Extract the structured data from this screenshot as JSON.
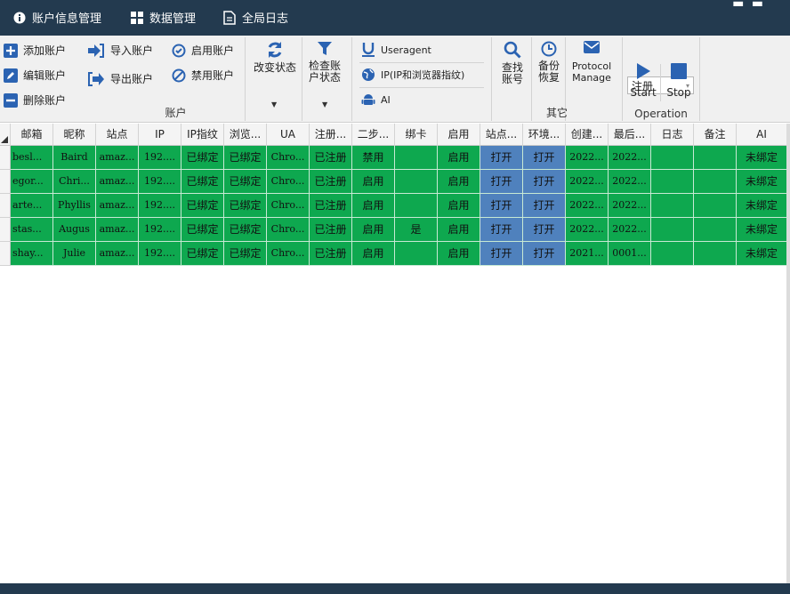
{
  "topnav": [
    {
      "label": "账户信息管理",
      "icon": "info-icon"
    },
    {
      "label": "数据管理",
      "icon": "grid-icon"
    },
    {
      "label": "全局日志",
      "icon": "document-icon"
    }
  ],
  "ribbon": {
    "account": {
      "add": "添加账户",
      "edit": "编辑账户",
      "delete": "删除账户",
      "import": "导入账户",
      "export": "导出账户",
      "enable": "启用账户",
      "disable": "禁用账户",
      "change_status": "改变状态",
      "check_status": "检查账户状态",
      "label": "账户"
    },
    "profile": {
      "useragent": "Useragent",
      "ip_fp": "IP(IP和浏览器指纹)",
      "ai": "AI"
    },
    "other": {
      "find": "查找账号",
      "backup": "备份恢复",
      "protocol": "Protocol Manage",
      "label": "其它"
    },
    "operation": {
      "select_value": "注册",
      "start": "Start",
      "stop": "Stop",
      "label": "Operation"
    }
  },
  "colors": {
    "topbar": "#233a4f",
    "row_green": "#0ea84f",
    "cell_blue": "#4f81bd",
    "icon_blue": "#2b63b2"
  },
  "table": {
    "columns": [
      "邮箱",
      "昵称",
      "站点",
      "IP",
      "IP指纹",
      "浏览...",
      "UA",
      "注册...",
      "二步...",
      "绑卡",
      "启用",
      "站点...",
      "环境...",
      "创建...",
      "最后...",
      "日志",
      "备注",
      "AI"
    ],
    "rows": [
      [
        "besl...",
        "Baird",
        "amaz...",
        "192....",
        "已绑定",
        "已绑定",
        "Chro...",
        "已注册",
        "禁用",
        "",
        "启用",
        "打开",
        "打开",
        "2022...",
        "2022...",
        "",
        "",
        "未绑定"
      ],
      [
        "egor...",
        "Chri...",
        "amaz...",
        "192....",
        "已绑定",
        "已绑定",
        "Chro...",
        "已注册",
        "启用",
        "",
        "启用",
        "打开",
        "打开",
        "2022...",
        "2022...",
        "",
        "",
        "未绑定"
      ],
      [
        "arte...",
        "Phyllis",
        "amaz...",
        "192....",
        "已绑定",
        "已绑定",
        "Chro...",
        "已注册",
        "启用",
        "",
        "启用",
        "打开",
        "打开",
        "2022...",
        "2022...",
        "",
        "",
        "未绑定"
      ],
      [
        "stas...",
        "Augus",
        "amaz...",
        "192....",
        "已绑定",
        "已绑定",
        "Chro...",
        "已注册",
        "启用",
        "是",
        "启用",
        "打开",
        "打开",
        "2022...",
        "2022...",
        "",
        "",
        "未绑定"
      ],
      [
        "shay...",
        "Julie",
        "amaz...",
        "192....",
        "已绑定",
        "已绑定",
        "Chro...",
        "已注册",
        "启用",
        "",
        "启用",
        "打开",
        "打开",
        "2021...",
        "0001...",
        "",
        "",
        "未绑定"
      ]
    ]
  }
}
